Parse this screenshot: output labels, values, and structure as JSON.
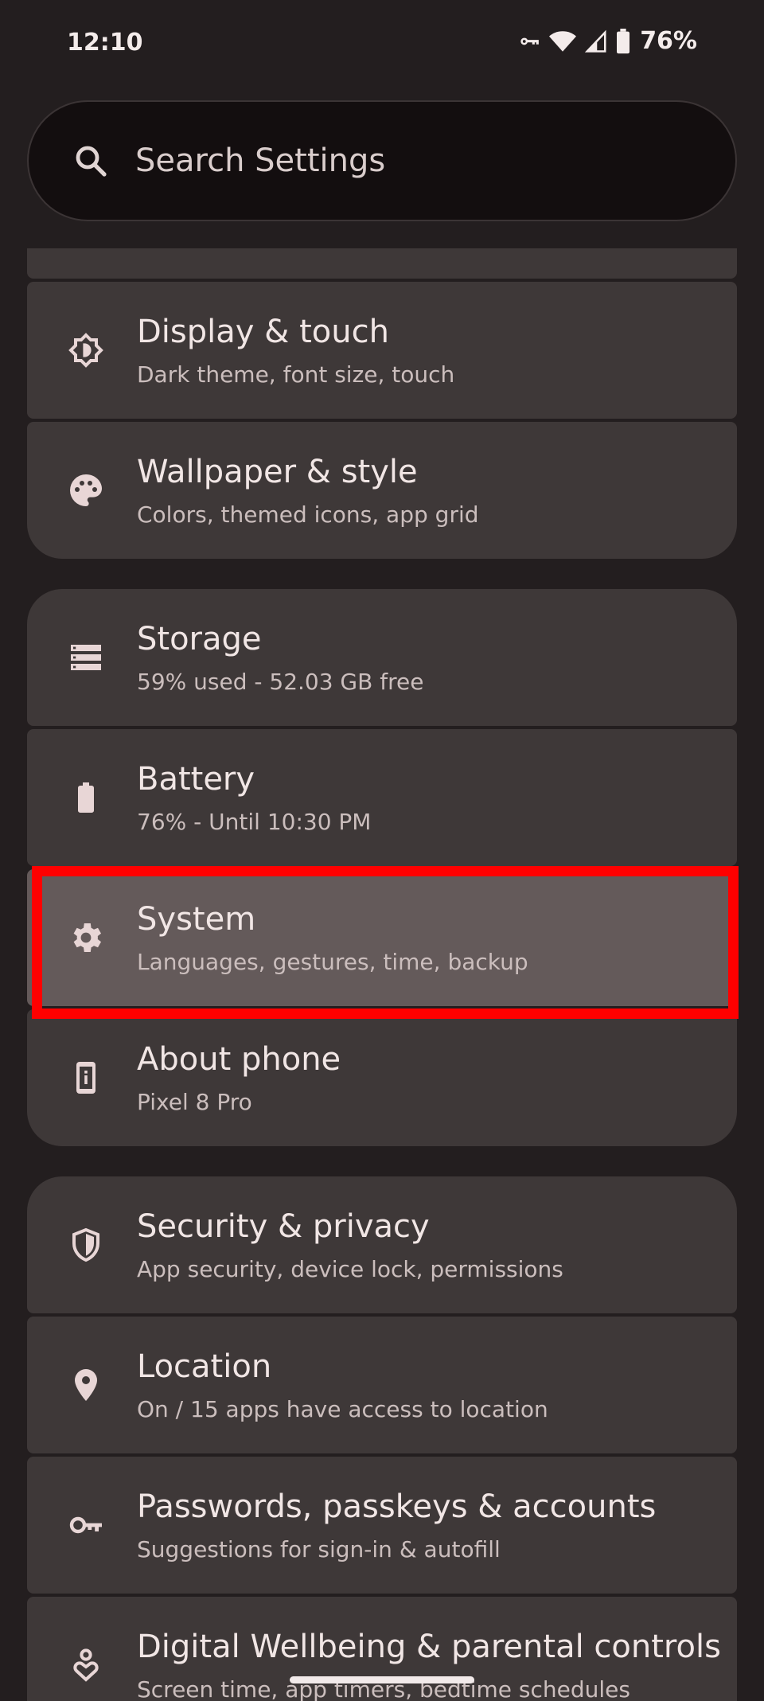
{
  "status_bar": {
    "time": "12:10",
    "battery_percent": "76%",
    "icons": [
      "vpn-key-icon",
      "wifi-icon",
      "cell-signal-icon",
      "battery-icon"
    ]
  },
  "search": {
    "placeholder": "Search Settings"
  },
  "settings": [
    {
      "title": "Display & touch",
      "subtitle": "Dark theme, font size, touch",
      "icon": "display-brightness-icon"
    },
    {
      "title": "Wallpaper & style",
      "subtitle": "Colors, themed icons, app grid",
      "icon": "palette-icon"
    },
    {
      "title": "Storage",
      "subtitle": "59% used - 52.03 GB free",
      "icon": "storage-icon"
    },
    {
      "title": "Battery",
      "subtitle": "76% - Until 10:30 PM",
      "icon": "battery-icon"
    },
    {
      "title": "System",
      "subtitle": "Languages, gestures, time, backup",
      "icon": "gear-icon",
      "selected": true
    },
    {
      "title": "About phone",
      "subtitle": "Pixel 8 Pro",
      "icon": "phone-info-icon"
    },
    {
      "title": "Security & privacy",
      "subtitle": "App security, device lock, permissions",
      "icon": "shield-icon"
    },
    {
      "title": "Location",
      "subtitle": "On / 15 apps have access to location",
      "icon": "location-pin-icon"
    },
    {
      "title": "Passwords, passkeys & accounts",
      "subtitle": "Suggestions for sign-in & autofill",
      "icon": "key-icon"
    },
    {
      "title": "Digital Wellbeing & parental controls",
      "subtitle": "Screen time, app timers, bedtime schedules",
      "icon": "wellbeing-icon"
    }
  ],
  "colors": {
    "background": "#231e1f",
    "card": "#3e3838",
    "selected_card": "#645a5a",
    "highlight_border": "#ff0000",
    "icon": "#e8d6d6"
  }
}
